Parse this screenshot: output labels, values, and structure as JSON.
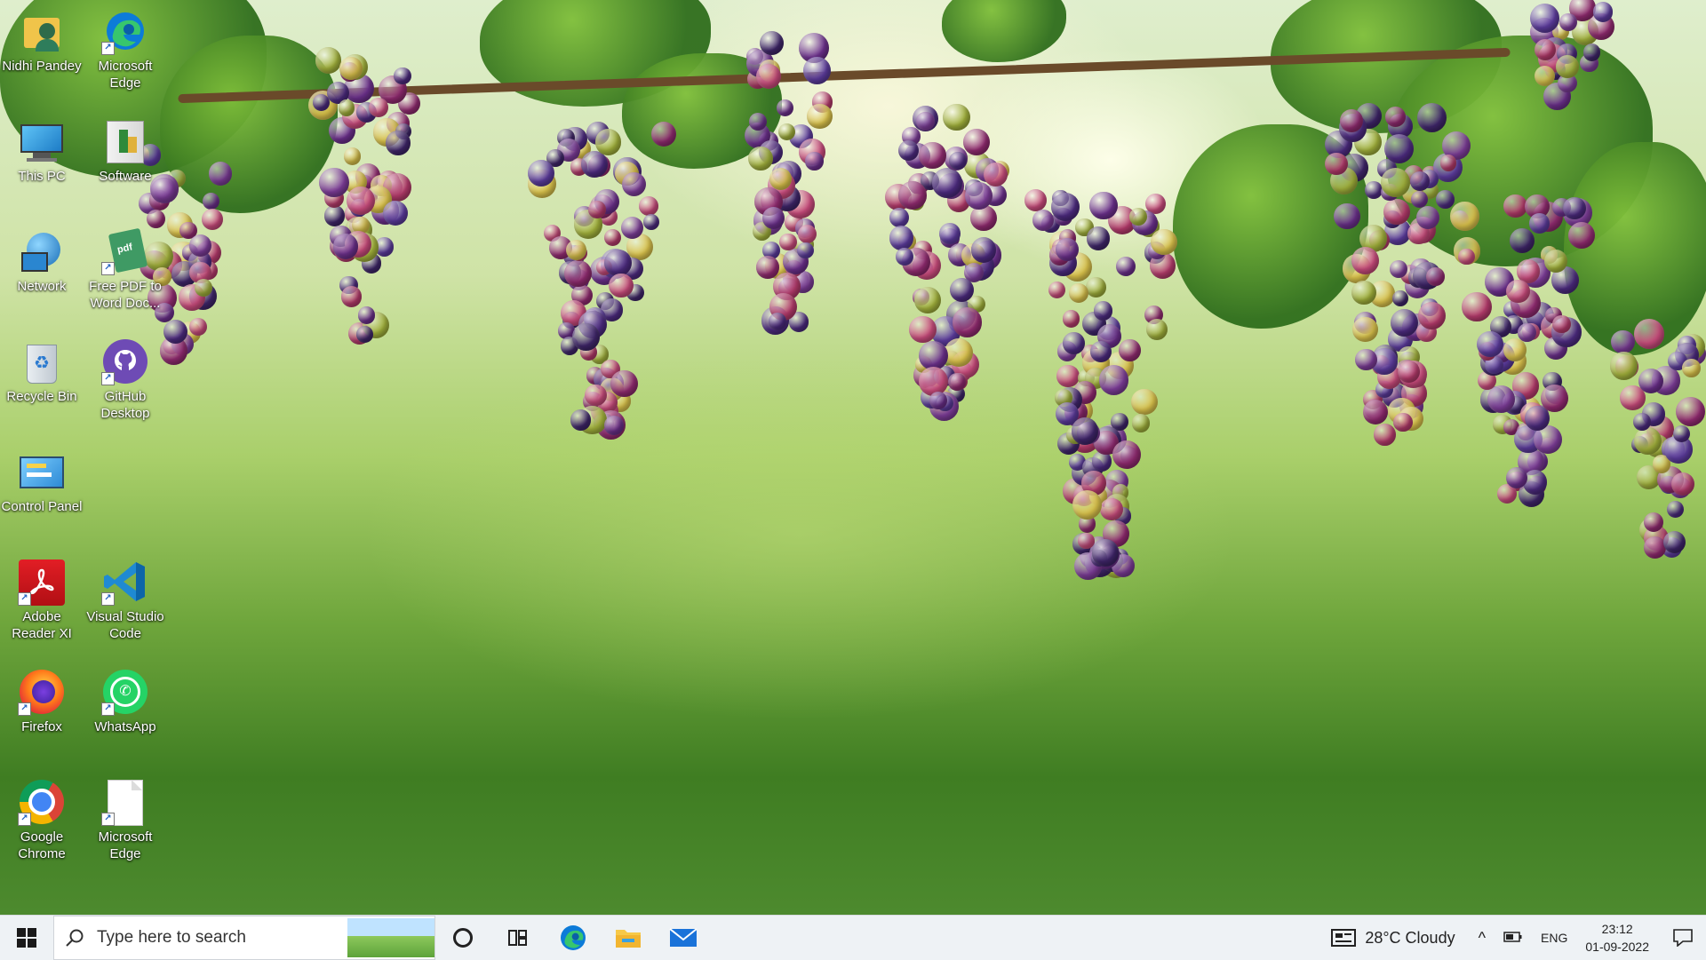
{
  "desktop_icons": [
    {
      "label": "Nidhi Pandey",
      "icon": "user-folder-icon"
    },
    {
      "label": "Microsoft Edge",
      "icon": "edge-icon"
    },
    {
      "label": "This PC",
      "icon": "computer-icon"
    },
    {
      "label": "Software",
      "icon": "software-folder-icon"
    },
    {
      "label": "Network",
      "icon": "network-icon"
    },
    {
      "label": "Free PDF to Word Doc...",
      "icon": "pdf-converter-icon"
    },
    {
      "label": "Recycle Bin",
      "icon": "recycle-bin-icon"
    },
    {
      "label": "GitHub Desktop",
      "icon": "github-icon"
    },
    {
      "label": "Control Panel",
      "icon": "control-panel-icon"
    },
    {
      "label": "Adobe Reader XI",
      "icon": "adobe-reader-icon"
    },
    {
      "label": "Visual Studio Code",
      "icon": "vscode-icon"
    },
    {
      "label": "Firefox",
      "icon": "firefox-icon"
    },
    {
      "label": "WhatsApp",
      "icon": "whatsapp-icon"
    },
    {
      "label": "Google Chrome",
      "icon": "chrome-icon"
    },
    {
      "label": "Microsoft Edge",
      "icon": "blank-file-icon"
    }
  ],
  "taskbar": {
    "search_placeholder": "Type here to search",
    "pinned": [
      "cortana-icon",
      "task-view-icon",
      "edge-icon",
      "file-explorer-icon",
      "mail-icon"
    ],
    "weather": "28°C Cloudy",
    "language": "ENG",
    "time": "23:12",
    "date": "01-09-2022"
  },
  "colors": {
    "taskbar_bg": "#eef2f5",
    "edge_blue": "#0c7bd8",
    "adobe_red": "#d4161c",
    "vscode_blue": "#1f8ad2",
    "whatsapp_green": "#25d366",
    "github_purple": "#6e4bb5"
  }
}
